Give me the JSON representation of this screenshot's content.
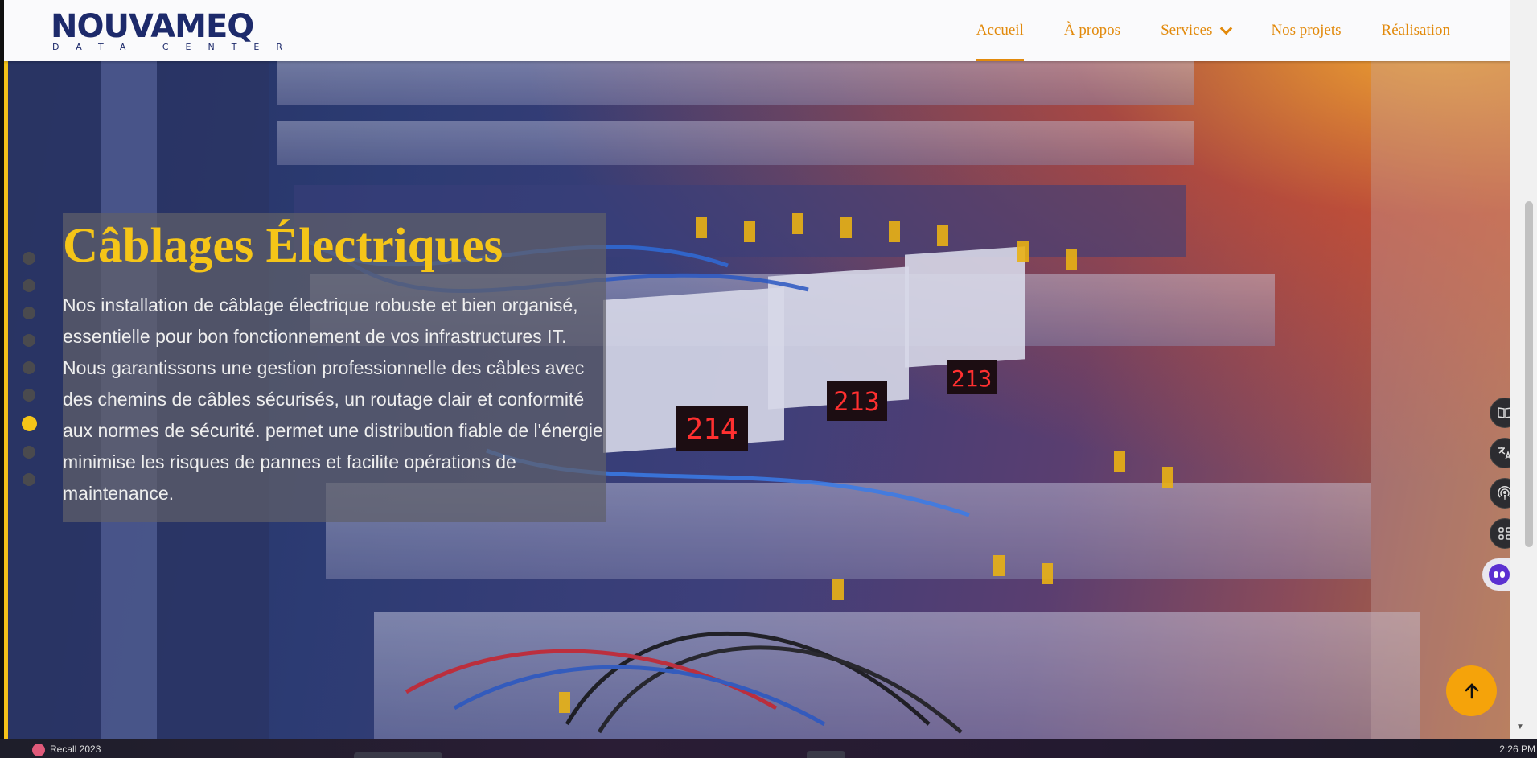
{
  "logo": {
    "wordmark": "NOUVAMEQ",
    "tagline": "DATA CENTER"
  },
  "nav": {
    "items": [
      {
        "label": "Accueil",
        "active": true
      },
      {
        "label": "À propos",
        "active": false
      },
      {
        "label": "Services",
        "active": false,
        "has_dropdown": true
      },
      {
        "label": "Nos projets",
        "active": false
      },
      {
        "label": "Réalisation",
        "active": false
      }
    ]
  },
  "hero": {
    "title": "Câblages Électriques",
    "text": "Nos installation de câblage électrique robuste et bien organisé, essentielle pour bon fonctionnement de vos infrastructures IT. Nous garantissons une gestion professionnelle des câbles avec des chemins de câbles sécurisés, un routage clair et conformité aux normes de sécurité. permet une distribution fiable de l'énergie minimise les risques de pannes et facilite opérations de maintenance.",
    "background": "electrical-panel-photo",
    "slide_count": 9,
    "active_slide": 7
  },
  "meter_readouts": [
    "214",
    "213",
    "213"
  ],
  "side_tools": [
    "book-icon",
    "translate-icon",
    "podcast-icon",
    "apps-icon"
  ],
  "assistant": {
    "icon": "assistant-robot-icon"
  },
  "back_to_top": {
    "icon": "arrow-up-icon"
  },
  "taskbar": {
    "item_text": "Recall 2023",
    "clock": "2:26 PM"
  },
  "colors": {
    "accent": "#e28a0c",
    "title_yellow": "#f5c518",
    "brand_navy": "#1d2a6b",
    "back_to_top": "#f5a30a"
  }
}
